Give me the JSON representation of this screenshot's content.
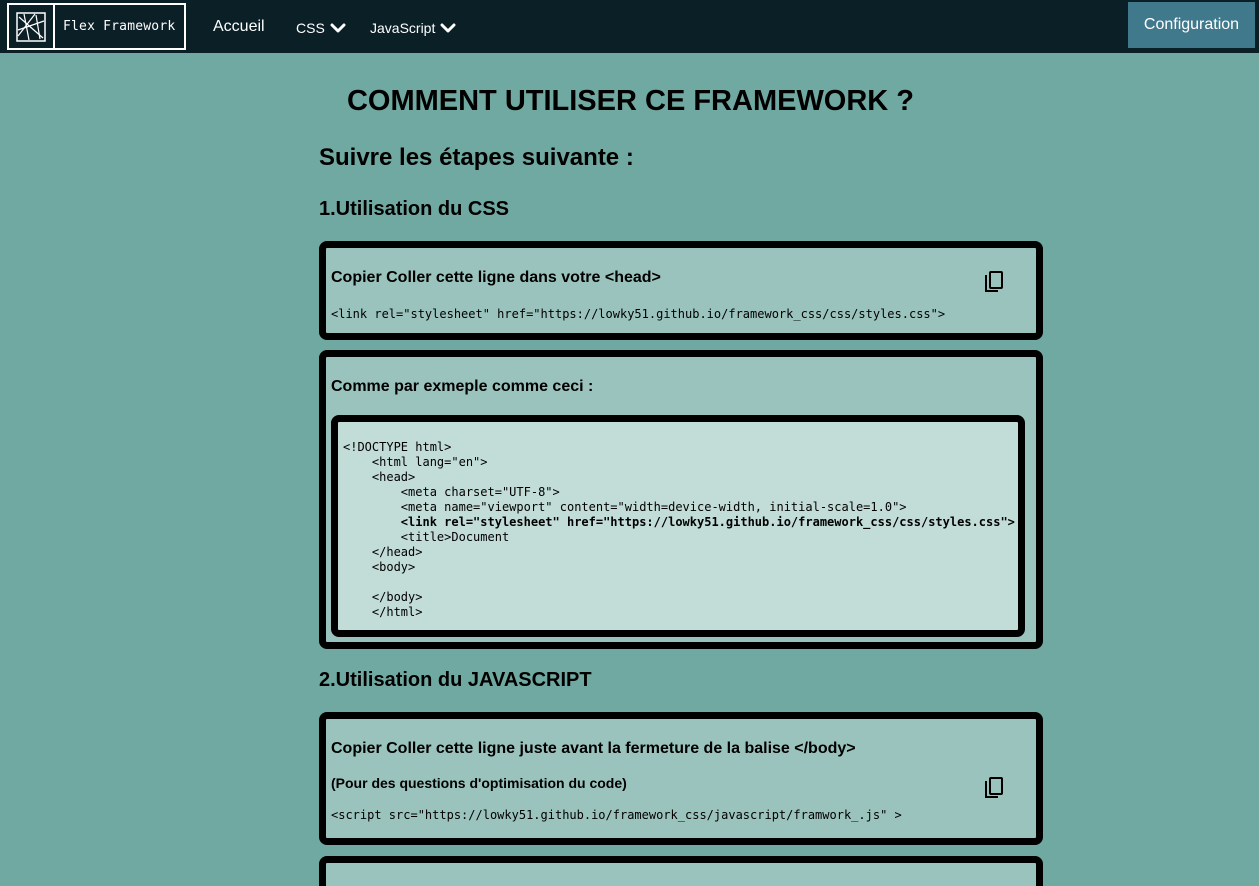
{
  "navbar": {
    "logo_text": "Flex Framework",
    "links": [
      "Accueil",
      "CSS",
      "JavaScript"
    ],
    "config_label": "Configuration"
  },
  "main": {
    "title": "COMMENT UTILISER CE FRAMEWORK ?",
    "subtitle": "Suivre les étapes suivante :",
    "section1": {
      "heading": "1.Utilisation du CSS",
      "card1": {
        "title": "Copier Coller cette ligne dans votre <head>",
        "code": "<link rel=\"stylesheet\" href=\"https://lowky51.github.io/framework_css/css/styles.css\">"
      },
      "card2": {
        "title": "Comme par exmeple comme ceci :",
        "code_lines": [
          "<!DOCTYPE html>",
          "    <html lang=\"en\">",
          "    <head>",
          "        <meta charset=\"UTF-8\">",
          "        <meta name=\"viewport\" content=\"width=device-width, initial-scale=1.0\">",
          "        <link rel=\"stylesheet\" href=\"https://lowky51.github.io/framework_css/css/styles.css\">",
          "        <title>Document",
          "    </head>",
          "    <body>",
          "",
          "    </body>",
          "    </html>"
        ]
      }
    },
    "section2": {
      "heading": "2.Utilisation du JAVASCRIPT",
      "card1": {
        "title": "Copier Coller cette ligne juste avant la fermeture de la balise </body>",
        "subtitle": "(Pour des questions d'optimisation du code)",
        "code": "<script src=\"https://lowky51.github.io/framework_css/javascript/framwork_.js\" >"
      }
    }
  },
  "icons": [
    "logo-icon",
    "chevron-down-icon",
    "copy-icon"
  ],
  "colors": {
    "background": "#70a9a1",
    "navbar": "#0b1f27",
    "button": "#40798c",
    "card": "#9bc3bd",
    "code_box": "#c2dcd7"
  }
}
